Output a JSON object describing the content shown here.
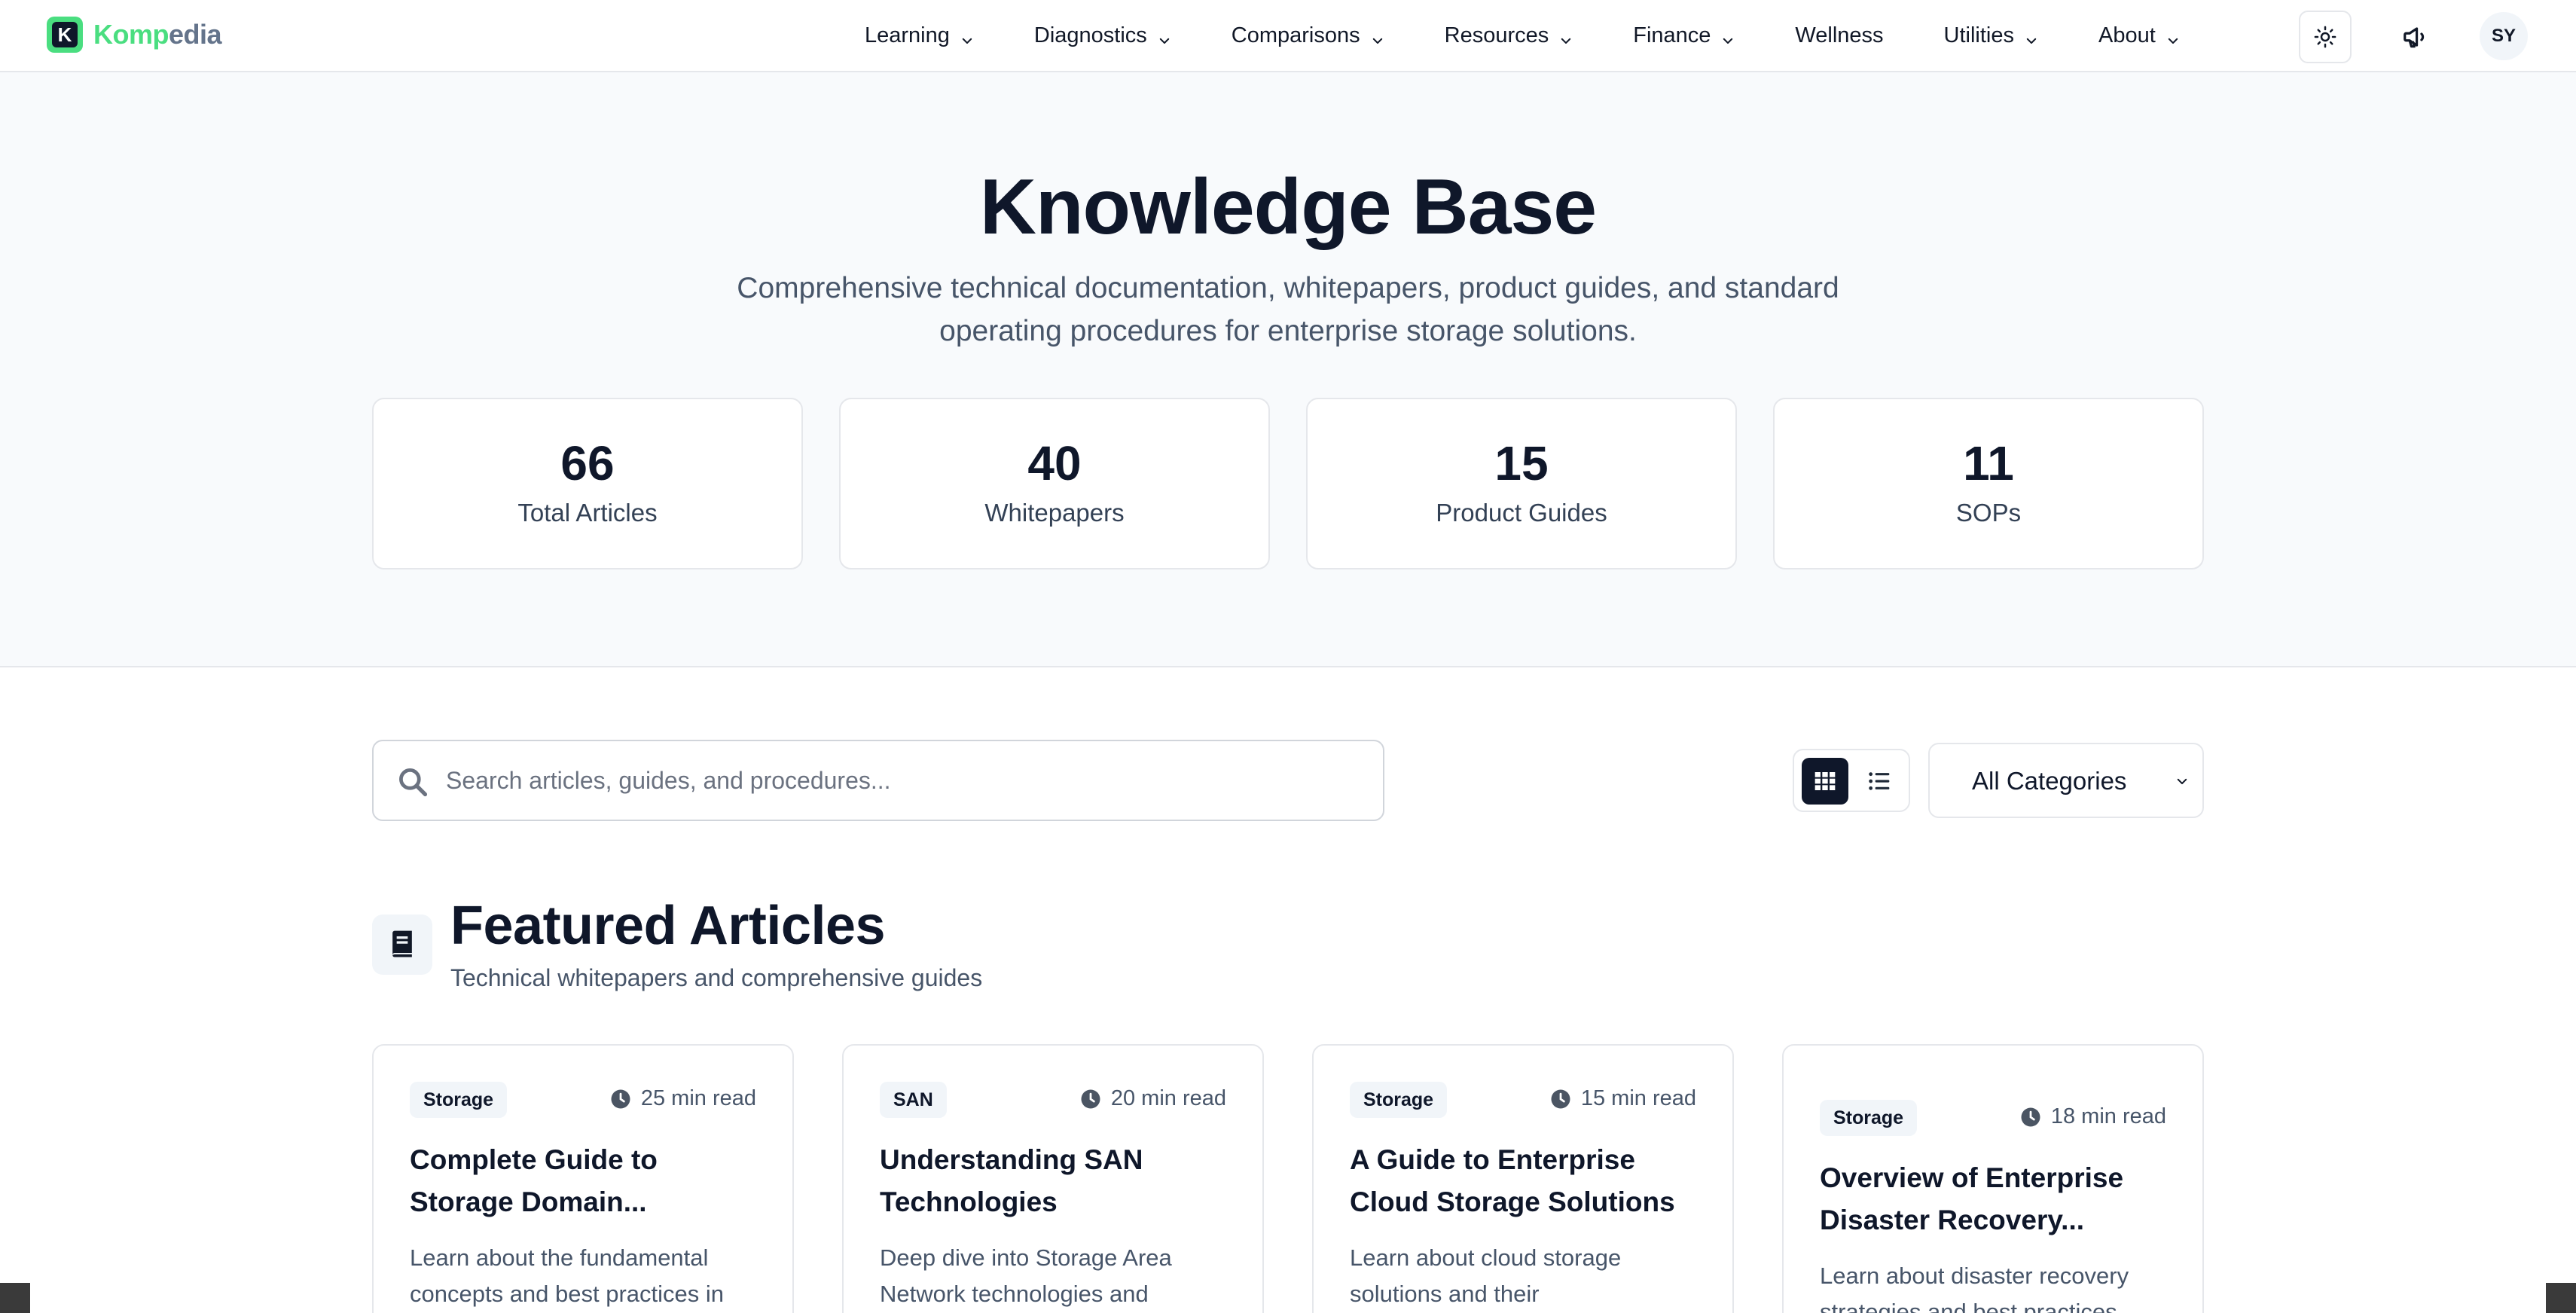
{
  "brand": {
    "name_part1": "Komp",
    "name_part2": "edia",
    "badge_letter": "K",
    "accent": "#4ade80"
  },
  "nav": {
    "items": [
      {
        "label": "Learning",
        "dropdown": true
      },
      {
        "label": "Diagnostics",
        "dropdown": true
      },
      {
        "label": "Comparisons",
        "dropdown": true
      },
      {
        "label": "Resources",
        "dropdown": true
      },
      {
        "label": "Finance",
        "dropdown": true
      },
      {
        "label": "Wellness",
        "dropdown": false
      },
      {
        "label": "Utilities",
        "dropdown": true
      },
      {
        "label": "About",
        "dropdown": true
      }
    ],
    "theme_icon": "sun-icon",
    "announce_icon": "megaphone-icon",
    "avatar_initials": "SY"
  },
  "hero": {
    "title": "Knowledge Base",
    "subtitle": "Comprehensive technical documentation, whitepapers, product guides, and standard operating procedures for enterprise storage solutions.",
    "stats": [
      {
        "value": "66",
        "label": "Total Articles"
      },
      {
        "value": "40",
        "label": "Whitepapers"
      },
      {
        "value": "15",
        "label": "Product Guides"
      },
      {
        "value": "11",
        "label": "SOPs"
      }
    ]
  },
  "controls": {
    "search_placeholder": "Search articles, guides, and procedures...",
    "search_value": "",
    "view_mode": "grid",
    "category_selected": "All Categories"
  },
  "featured": {
    "title": "Featured Articles",
    "subtitle": "Technical whitepapers and comprehensive guides",
    "cards": [
      {
        "badge": "Storage",
        "read_time": "25 min read",
        "title": "Complete Guide to Storage Domain...",
        "desc": "Learn about the fundamental concepts and best practices in"
      },
      {
        "badge": "SAN",
        "read_time": "20 min read",
        "title": "Understanding SAN Technologies",
        "desc": "Deep dive into Storage Area Network technologies and"
      },
      {
        "badge": "Storage",
        "read_time": "15 min read",
        "title": "A Guide to Enterprise Cloud Storage Solutions",
        "desc": "Learn about cloud storage solutions and their"
      },
      {
        "badge": "Storage",
        "read_time": "18 min read",
        "title": "Overview of Enterprise Disaster Recovery...",
        "desc": "Learn about disaster recovery strategies and best practices"
      }
    ]
  }
}
